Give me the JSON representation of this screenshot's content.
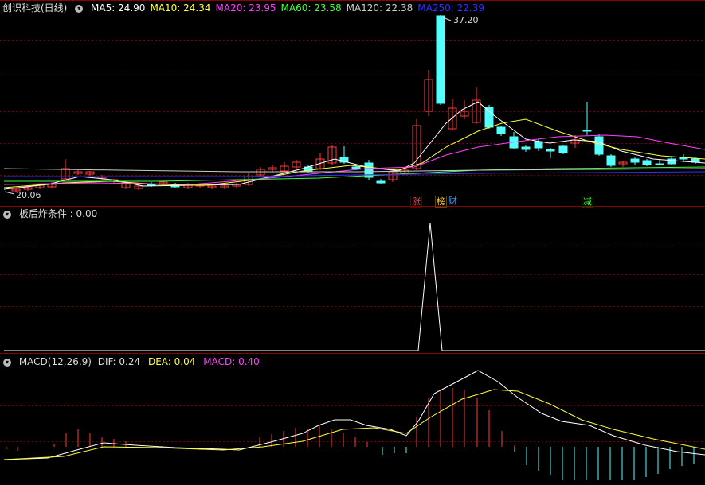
{
  "main_panel": {
    "title": "创识科技(日线)",
    "indicators": [
      {
        "label": "MA5:",
        "value": "24.90",
        "color": "#ffffff"
      },
      {
        "label": "MA10:",
        "value": "24.34",
        "color": "#ffff40"
      },
      {
        "label": "MA20:",
        "value": "23.95",
        "color": "#ff40ff"
      },
      {
        "label": "MA60:",
        "value": "23.58",
        "color": "#40ff40"
      },
      {
        "label": "MA120:",
        "value": "22.38",
        "color": "#cccccc"
      },
      {
        "label": "MA250:",
        "value": "22.39",
        "color": "#3030ff"
      }
    ],
    "high_label": "37.20",
    "low_label": "20.06",
    "tags": [
      "涨",
      "榜",
      "财",
      "减"
    ]
  },
  "panel2": {
    "title": "板后炸条件",
    "value_text": ": 0.00"
  },
  "panel3": {
    "title": "MACD(12,26,9)",
    "dif": {
      "label": "DIF:",
      "value": "0.24"
    },
    "dea": {
      "label": "DEA:",
      "value": "0.04"
    },
    "macd": {
      "label": "MACD:",
      "value": "0.40"
    }
  },
  "colors": {
    "up": "#ff3c3c",
    "down": "#54ffff",
    "grid": "#7a0000",
    "border": "#8b0000"
  }
}
